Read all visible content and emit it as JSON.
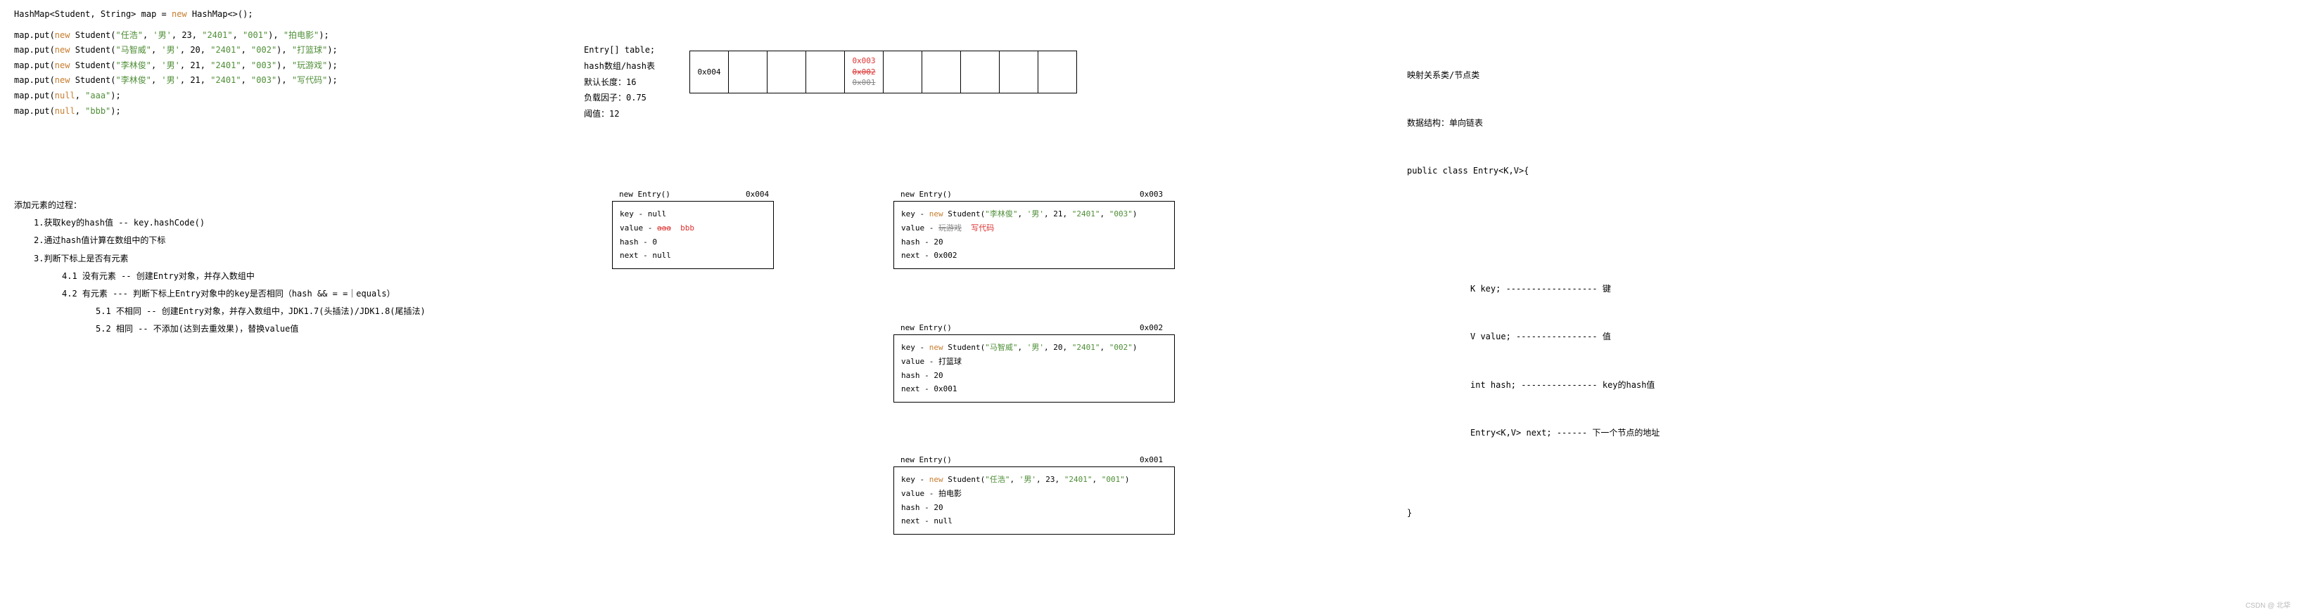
{
  "code": {
    "l1": "HashMap<Student, String> map = ",
    "new": "new",
    "l1b": " HashMap<>();",
    "l2a": "map.put(",
    "stud": " Student(",
    "s1": "\"任浩\"",
    "s1b": "'男'",
    "s1c": "23",
    "s1d": "\"2401\"",
    "s1e": "\"001\"",
    "s1f": "\"拍电影\"",
    "s2": "\"马智威\"",
    "s2b": "'男'",
    "s2c": "20",
    "s2d": "\"2401\"",
    "s2e": "\"002\"",
    "s2f": "\"打篮球\"",
    "s3": "\"李林俊\"",
    "s3b": "'男'",
    "s3c": "21",
    "s3d": "\"2401\"",
    "s3e": "\"003\"",
    "s3f": "\"玩游戏\"",
    "s4": "\"李林俊\"",
    "s4b": "'男'",
    "s4c": "21",
    "s4d": "\"2401\"",
    "s4e": "\"003\"",
    "s4f": "\"写代码\"",
    "n1": "null",
    "aaa": "\"aaa\"",
    "bbb": "\"bbb\""
  },
  "process": {
    "title": "添加元素的过程：",
    "p1": "1.获取key的hash值 -- key.hashCode()",
    "p2": "2.通过hash值计算在数组中的下标",
    "p3": "3.判断下标上是否有元素",
    "p41": "4.1 没有元素 -- 创建Entry对象，并存入数组中",
    "p42": "4.2 有元素 --- 判断下标上Entry对象中的key是否相同（hash && = =｜equals）",
    "p51": "5.1 不相同  -- 创建Entry对象，并存入数组中，JDK1.7(头插法)/JDK1.8(尾插法)",
    "p52": "5.2  相同   --  不添加(达到去重效果)，替换value值"
  },
  "tableInfo": {
    "t1": "Entry[] table;",
    "t2": "hash数组/hash表",
    "t3": "默认长度：16",
    "t4": "负载因子：0.75",
    "t5": "阈值：12"
  },
  "tableCells": {
    "c1": "0x004",
    "c3a": "0x003",
    "c3b": "0x002",
    "c3c": "0x001"
  },
  "entry004": {
    "label": "new Entry()",
    "addr": "0x004",
    "k": "key - null",
    "v1": "value - ",
    "v_old": "aaa",
    "v_new": "bbb",
    "h": "hash - 0",
    "n": "next - null"
  },
  "entry003": {
    "label": "new Entry()",
    "addr": "0x003",
    "kpre": "key - ",
    "v1": "value - ",
    "v_old": "玩游戏",
    "v_new": "写代码",
    "h": "hash - 20",
    "n": "next - 0x002"
  },
  "entry002": {
    "label": "new Entry()",
    "addr": "0x002",
    "kpre": "key - ",
    "v": "value - 打篮球",
    "h": "hash - 20",
    "n": "next - 0x001"
  },
  "entry001": {
    "label": "new Entry()",
    "addr": "0x001",
    "kpre": "key - ",
    "v": "value - 拍电影",
    "h": "hash - 20",
    "n": "next - null"
  },
  "right": {
    "r1": "映射关系类/节点类",
    "r2": "数据结构：单向链表",
    "r3": "public class Entry<K,V>{",
    "r4": "K key; ------------------ 键",
    "r5": "V value; ---------------- 值",
    "r6": "int hash; --------------- key的hash值",
    "r7": "Entry<K,V> next; ------ 下一个节点的地址",
    "r8": "}"
  },
  "watermark": "CSDN @ 北牮"
}
